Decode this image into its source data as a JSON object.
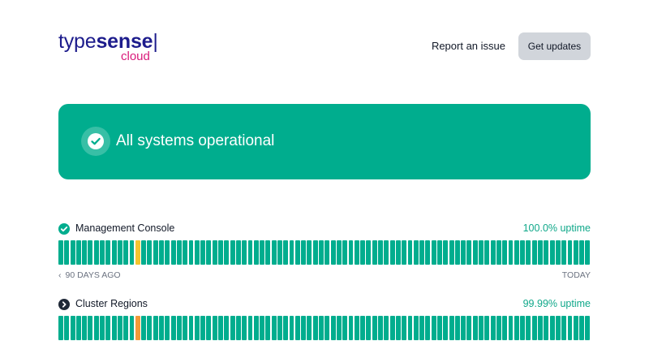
{
  "header": {
    "logo": {
      "type": "type",
      "sense": "sense",
      "bar": "|",
      "sub": "cloud"
    },
    "report_link": "Report an issue",
    "updates_button": "Get updates"
  },
  "colors": {
    "operational": "#00ad8e",
    "degraded": "#f4c430",
    "partial_outage": "#f29a38",
    "gray_button": "#d1d5db",
    "brand_navy": "#1d1c8c",
    "brand_pink": "#d9197a"
  },
  "banner": {
    "icon": "check-circle-icon",
    "text": "All systems operational"
  },
  "components": [
    {
      "name": "Management Console",
      "icon": "check-circle-icon",
      "uptime": "100.0% uptime",
      "days": 90,
      "incident_days": [
        {
          "index": 13,
          "status": "degraded",
          "fill": 0.4
        }
      ],
      "axis_start": "90 DAYS AGO",
      "axis_end": "TODAY"
    },
    {
      "name": "Cluster Regions",
      "icon": "chevron-right-circle-icon",
      "uptime": "99.99% uptime",
      "days": 90,
      "incident_days": [
        {
          "index": 13,
          "status": "partial_outage",
          "fill": 0.3
        }
      ]
    }
  ]
}
